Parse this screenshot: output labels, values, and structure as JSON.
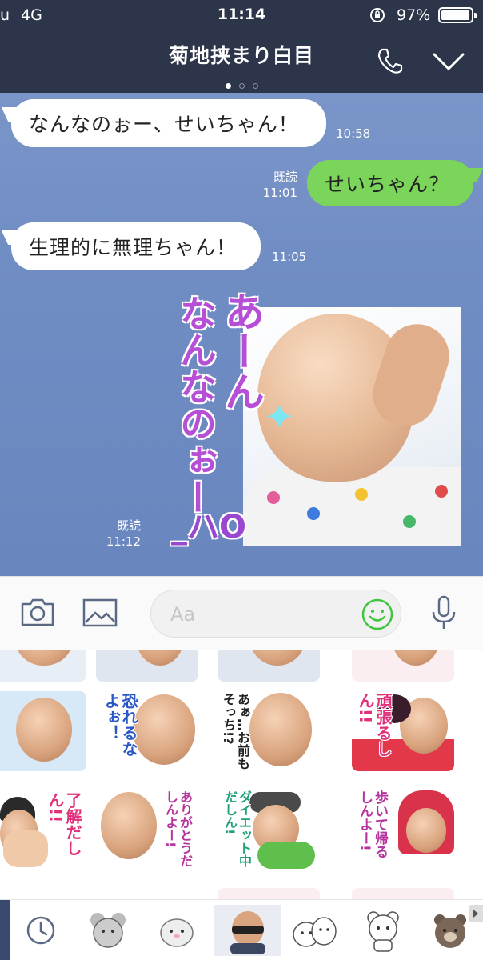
{
  "status_bar": {
    "carrier": "u",
    "network": "4G",
    "time": "11:14",
    "battery": "97%",
    "battery_level": 0.97
  },
  "header": {
    "title": "菊地挟まり白目",
    "page_indicator_count": 3,
    "page_indicator_active": 0
  },
  "messages": [
    {
      "direction": "in",
      "text": "なんなのぉー、せいちゃん！",
      "time": "10:58"
    },
    {
      "direction": "out",
      "text": "せいちゃん？",
      "read": "既読",
      "time": "11:01"
    },
    {
      "direction": "in",
      "text": "生理的に無理ちゃん！",
      "time": "11:05"
    },
    {
      "direction": "out",
      "type": "sticker",
      "read": "既読",
      "time": "11:12",
      "sticker_text_1": "あーん",
      "sticker_text_2": "なんなのぉー",
      "sticker_signature": "_ハO"
    }
  ],
  "input": {
    "placeholder": "Aa",
    "icons": [
      "camera-icon",
      "image-icon",
      "emoji-icon",
      "microphone-icon"
    ]
  },
  "sticker_grid": {
    "captions": [
      "恐れるなよぉ！",
      "あぁ…お前もそっち!?",
      "頑張るしん!!",
      "了解だしん!!",
      "ありがとうだしんよー!",
      "ダイエット中だしん!",
      "歩いて帰るしんよー!"
    ]
  },
  "tabs": {
    "selected_index": 3,
    "icons": [
      "history-icon",
      "mouse-sticker-icon",
      "hamster-sticker-icon",
      "bald-man-sticker-icon",
      "bear-friends-sticker-icon",
      "bear-sticker-icon",
      "brown-sticker-icon"
    ]
  },
  "colors": {
    "header": "#2c3549",
    "chat_bg": "#7590c6",
    "outgoing_bubble": "#7bd55b",
    "emoji_green": "#3fc53f"
  }
}
